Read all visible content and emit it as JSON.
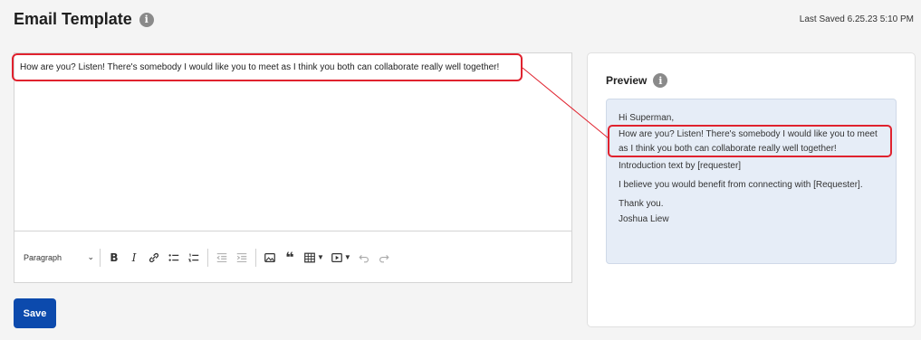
{
  "header": {
    "title": "Email Template",
    "info_icon": "info-icon",
    "last_saved": "Last Saved 6.25.23 5:10 PM"
  },
  "editor": {
    "content": "How are you? Listen! There's somebody I would like you to meet as I think you both can collaborate really well together!",
    "toolbar": {
      "format_select": "Paragraph",
      "buttons": [
        "bold-icon",
        "italic-icon",
        "link-icon",
        "bulleted-list-icon",
        "numbered-list-icon",
        "outdent-icon",
        "indent-icon",
        "image-icon",
        "quote-icon",
        "table-icon",
        "media-icon",
        "undo-icon",
        "redo-icon"
      ]
    }
  },
  "actions": {
    "save_label": "Save"
  },
  "preview": {
    "title": "Preview",
    "lines": {
      "greeting": "Hi Superman,",
      "body_1": "How are you? Listen! There's somebody I would like you to meet",
      "body_2": "as I think you both can collaborate really well together!",
      "intro": "Introduction text by [requester]",
      "benefit": "I believe you would benefit from connecting with [Requester].",
      "thanks": "Thank you.",
      "signature": "Joshua Liew"
    }
  },
  "annotation_color": "#e0222e",
  "accent_color": "#0c4aad"
}
